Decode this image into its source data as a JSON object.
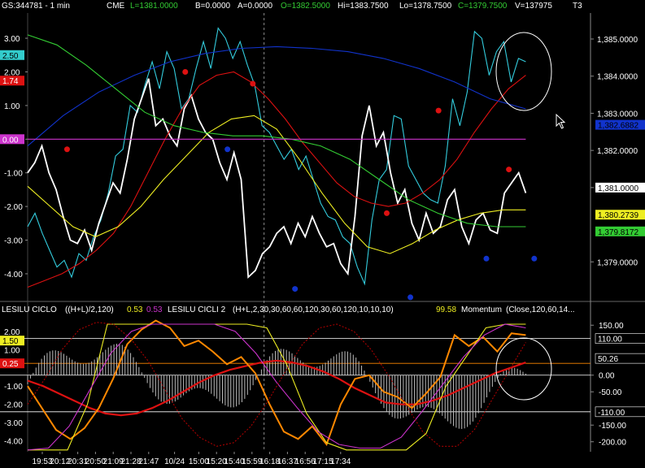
{
  "header": {
    "symbol": "GS:344781 - 1 min",
    "exchange": "CME",
    "last": "L=1381.0000",
    "bid": "B=0.0000",
    "ask": "A=0.0000",
    "open": "O=1382.5000",
    "high": "Hi=1383.7500",
    "low": "Lo=1378.7500",
    "close": "C=1379.7500",
    "volume": "V=137975",
    "tf": "T3"
  },
  "lower_header": {
    "ind1_name": "LESILU CICLO",
    "ind1_params": "((H+L)/2,120)",
    "ind1_val": "0.53",
    "ind1_val2": "0.53",
    "ind2_name": "LESILU CICLI 2",
    "ind2_params": "(H+L,2,30,30,60,60,120,30,60,120,10,10,10)",
    "ind2_val": "99.58",
    "ind3_name": "Momentum",
    "ind3_params": "(Close,120,60,14..."
  },
  "colors": {
    "cyan": "#33ccdd",
    "white": "#ffffff",
    "red": "#dd1111",
    "blue": "#1133cc",
    "yellow": "#eeee22",
    "green": "#33cc33",
    "magenta": "#cc33cc",
    "orange": "#ff8800",
    "darkred": "#aa0000"
  },
  "chart_data": [
    {
      "type": "line",
      "title": "",
      "x_ticks": [
        "19:53",
        "20:12",
        "20:31",
        "20:50",
        "21:09",
        "21:28",
        "21:47",
        "10/24",
        "15:00",
        "15:20",
        "15:40",
        "15:59",
        "16:18",
        "16:37",
        "16:56",
        "17:15",
        "17:34"
      ],
      "left_axis": {
        "ticks": [
          "3.00",
          "2.00",
          "1.00",
          "0.00",
          "-1.00",
          "-2.00",
          "-3.00",
          "-4.00"
        ],
        "ylim": [
          -4.75,
          3.75
        ]
      },
      "right_axis": {
        "ticks": [
          "1,385.0000",
          "1,384.0000",
          "1,383.0000",
          "1,382.0000",
          "1,381.0000",
          "1,379.0000"
        ],
        "ylim": [
          1378.0,
          1385.7
        ]
      },
      "badges_left": [
        {
          "text": "2.50",
          "value": 2.5,
          "bg": "#33cccc",
          "fg": "#000000"
        },
        {
          "text": "1.74",
          "value": 1.74,
          "bg": "#dd1111",
          "fg": "#ffffff"
        },
        {
          "text": "0.00",
          "value": 0.0,
          "bg": "#cc33cc",
          "fg": "#ffffff"
        }
      ],
      "badges_right": [
        {
          "text": "1,382.6882",
          "value": 1382.69,
          "bg": "#1133cc",
          "fg": "#000000"
        },
        {
          "text": "1,381.0000",
          "value": 1381.0,
          "bg": "#ffffff",
          "fg": "#000000"
        },
        {
          "text": "1,380.2739",
          "value": 1380.27,
          "bg": "#eeee22",
          "fg": "#000000"
        },
        {
          "text": "1,379.8172",
          "value": 1379.82,
          "bg": "#33cc33",
          "fg": "#000000"
        }
      ],
      "series": [
        {
          "color": "#33ccdd",
          "axis": "left",
          "values": [
            -2.6,
            -2.2,
            -2.8,
            -3.3,
            -3.8,
            -3.6,
            -4.1,
            -3.4,
            -3.6,
            -2.9,
            -2.4,
            -1.6,
            -0.5,
            -0.3,
            1.0,
            0.8,
            1.6,
            2.3,
            1.5,
            2.6,
            2.1,
            0.9,
            1.2,
            2.1,
            2.9,
            2.1,
            3.3,
            3.0,
            2.4,
            2.9,
            2.2,
            1.6,
            0.4,
            0.2,
            -0.2,
            -0.6,
            -0.3,
            -0.9,
            -0.5,
            -1.2,
            -1.9,
            -2.3,
            -2.4,
            -2.9,
            -3.1,
            -3.8,
            -4.3,
            -2.4,
            -1.2,
            -0.9,
            0.7,
            0.6,
            -0.8,
            -1.2,
            -1.6,
            -1.8,
            -1.9,
            -0.8,
            1.2,
            0.4,
            1.4,
            3.2,
            3.0,
            1.9,
            2.6,
            2.9,
            1.7,
            2.4,
            2.3
          ]
        },
        {
          "color": "#ffffff",
          "axis": "left",
          "values": [
            -1.0,
            -0.7,
            -0.2,
            -1.0,
            -1.5,
            -2.3,
            -3.0,
            -3.1,
            -2.7,
            -3.3,
            -2.5,
            -1.9,
            -1.3,
            -1.6,
            -0.6,
            0.6,
            1.2,
            1.8,
            0.4,
            0.6,
            0.1,
            -0.2,
            0.9,
            1.3,
            0.6,
            0.2,
            0.0,
            -0.7,
            -1.2,
            -0.4,
            -1.2,
            -4.1,
            -3.9,
            -3.4,
            -3.2,
            -2.8,
            -2.6,
            -3.1,
            -2.5,
            -2.9,
            -2.3,
            -2.8,
            -3.2,
            -3.1,
            -3.7,
            -4.0,
            -2.3,
            0.1,
            1.0,
            -0.2,
            0.2,
            -1.0,
            -1.9,
            -1.5,
            -2.5,
            -3.0,
            -2.2,
            -2.8,
            -2.6,
            -1.8,
            -1.5,
            -2.6,
            -3.1,
            -2.4,
            -2.2,
            -2.7,
            -2.8,
            -1.6,
            -1.3,
            -1.0,
            -1.6
          ]
        },
        {
          "color": "#dd1111",
          "axis": "left",
          "values": [
            -4.4,
            -4.2,
            -4.0,
            -3.7,
            -3.3,
            -2.8,
            -2.0,
            -1.0,
            0.0,
            0.9,
            1.6,
            1.9,
            2.0,
            1.7,
            1.2,
            0.6,
            -0.1,
            -0.7,
            -1.3,
            -1.7,
            -1.9,
            -2.0,
            -1.9,
            -1.6,
            -1.2,
            -0.6,
            0.2,
            0.9,
            1.5,
            1.9
          ]
        },
        {
          "color": "#1133cc",
          "axis": "left",
          "values": [
            -0.2,
            0.7,
            1.4,
            1.9,
            2.3,
            2.55,
            2.7,
            2.75,
            2.7,
            2.6,
            2.4,
            2.1,
            1.7,
            1.2,
            0.9
          ]
        },
        {
          "color": "#eeee22",
          "axis": "left",
          "values": [
            -1.4,
            -2.0,
            -2.6,
            -2.9,
            -2.6,
            -2.0,
            -1.2,
            -0.5,
            0.2,
            0.6,
            0.7,
            0.3,
            -0.6,
            -1.6,
            -2.5,
            -3.2,
            -3.4,
            -3.1,
            -2.7,
            -2.4,
            -2.2,
            -2.1,
            -2.1
          ]
        },
        {
          "color": "#33cc33",
          "axis": "left",
          "values": [
            3.1,
            2.8,
            2.2,
            1.5,
            0.8,
            0.4,
            0.2,
            0.1,
            0.1,
            0.0,
            -0.2,
            -0.6,
            -1.2,
            -1.8,
            -2.2,
            -2.5,
            -2.6,
            -2.6
          ]
        },
        {
          "color": "#cc33cc",
          "axis": "left",
          "values": [
            0.0,
            0.0
          ]
        }
      ],
      "markers": [
        {
          "color": "#dd1111",
          "label": "hi",
          "t": 0.07,
          "v": -0.3
        },
        {
          "color": "#dd1111",
          "label": "hi",
          "t": 0.28,
          "v": 2.0
        },
        {
          "color": "#dd1111",
          "label": "hi",
          "t": 0.4,
          "v": 1.65
        },
        {
          "color": "#dd1111",
          "label": "hi",
          "t": 0.638,
          "v": -2.2
        },
        {
          "color": "#dd1111",
          "label": "hi",
          "t": 0.73,
          "v": 0.85
        },
        {
          "color": "#dd1111",
          "label": "hi",
          "t": 0.855,
          "v": -0.9
        },
        {
          "color": "#1133cc",
          "label": "lo",
          "t": 0.355,
          "v": -0.3
        },
        {
          "color": "#1133cc",
          "label": "lo",
          "t": 0.475,
          "v": -4.45
        },
        {
          "color": "#1133cc",
          "label": "lo",
          "t": 0.68,
          "v": -4.7
        },
        {
          "color": "#1133cc",
          "label": "lo",
          "t": 0.815,
          "v": -3.55
        },
        {
          "color": "#1133cc",
          "label": "lo",
          "t": 0.9,
          "v": -3.55
        }
      ],
      "vline_label": "10/24"
    },
    {
      "type": "line",
      "title": "",
      "left_axis": {
        "ticks": [
          "2.00",
          "1.00",
          "-1.00",
          "-2.00",
          "-3.00",
          "-4.00"
        ],
        "ylim": [
          -4.6,
          2.8
        ]
      },
      "right_axis": {
        "ticks": [
          "150.00",
          "0.00",
          "-50.00",
          "-150.00",
          "-200.00"
        ],
        "ylim": [
          -230,
          175
        ]
      },
      "badges_left": [
        {
          "text": "1.50",
          "value": 1.5,
          "bg": "#eeee22",
          "fg": "#000000"
        },
        {
          "text": "0.25",
          "value": 0.25,
          "bg": "#dd1111",
          "fg": "#ffffff"
        }
      ],
      "badges_right": [
        {
          "text": "110.00",
          "value": 110,
          "bg": "#000000",
          "fg": "#ffffff"
        },
        {
          "text": "50.26",
          "value": 50.26,
          "bg": "#000000",
          "fg": "#ffffff"
        },
        {
          "text": "-110.00",
          "value": -110,
          "bg": "#000000",
          "fg": "#ffffff"
        }
      ],
      "series": [
        {
          "color": "#dd1111",
          "axis": "left",
          "values": [
            -0.7,
            -1.0,
            -1.4,
            -1.8,
            -2.2,
            -2.5,
            -2.6,
            -2.5,
            -2.2,
            -1.8,
            -1.3,
            -0.8,
            -0.4,
            -0.1,
            0.1,
            0.3,
            0.4,
            0.3,
            0.1,
            -0.2,
            -0.6,
            -1.1,
            -1.5,
            -1.9,
            -2.0,
            -2.0,
            -1.8,
            -1.5,
            -1.1,
            -0.7,
            -0.3,
            0.0,
            0.3
          ]
        },
        {
          "color": "#ff8800",
          "axis": "left",
          "values": [
            -1.0,
            -2.2,
            -3.4,
            -3.9,
            -3.3,
            -2.2,
            -0.6,
            1.3,
            2.1,
            2.6,
            2.2,
            1.2,
            1.5,
            0.9,
            0.2,
            0.6,
            -0.3,
            -2.0,
            -3.5,
            -3.9,
            -3.2,
            -4.2,
            -2.0,
            -0.6,
            -0.4,
            -1.3,
            -1.6,
            -2.2,
            -1.4,
            -0.5,
            1.8,
            1.2,
            1.7,
            0.9,
            1.9,
            1.8
          ]
        },
        {
          "color": "#eeee22",
          "axis": "left",
          "values": [
            -4.5,
            -4.5,
            -4.5,
            -2.0,
            2.4,
            2.4,
            2.4,
            2.4,
            2.4,
            2.4,
            2.4,
            2.4,
            2.2,
            0.2,
            -2.5,
            -4.1,
            -4.5,
            -4.5,
            -4.5,
            -4.5,
            -3.6,
            -1.0,
            0.6,
            2.2,
            2.4,
            2.4
          ]
        },
        {
          "color": "#cc33cc",
          "axis": "left",
          "values": [
            -4.5,
            -4.4,
            -3.2,
            -1.2,
            0.8,
            2.0,
            2.4,
            2.4,
            2.4,
            2.4,
            2.0,
            0.8,
            -0.8,
            -2.2,
            -3.5,
            -4.2,
            -4.4,
            -4.4,
            -3.8,
            -2.4,
            -0.9,
            0.6,
            1.8,
            2.4,
            2.2
          ]
        },
        {
          "color": "#aa0000",
          "axis": "left",
          "values": [
            -2.0,
            -0.6,
            1.0,
            2.1,
            2.5,
            2.4,
            1.6,
            0.4,
            -1.2,
            -2.8,
            -3.8,
            -4.3,
            -4.1,
            -3.2,
            -1.8,
            -0.2,
            1.3,
            2.2,
            2.4,
            2.0,
            1.0,
            -0.4,
            -2.0,
            -3.5,
            -4.3,
            -4.3,
            -3.4,
            -1.8,
            -0.2,
            1.4
          ]
        }
      ],
      "hlines_right": [
        110,
        0,
        -110
      ]
    }
  ]
}
